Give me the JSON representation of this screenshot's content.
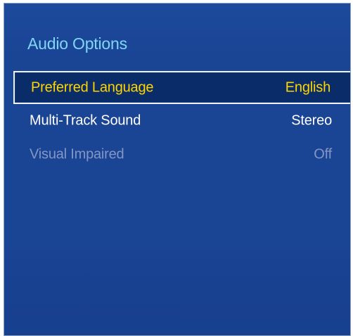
{
  "panel": {
    "title": "Audio Options"
  },
  "menu": {
    "items": [
      {
        "label": "Preferred Language",
        "value": "English",
        "state": "selected"
      },
      {
        "label": "Multi-Track Sound",
        "value": "Stereo",
        "state": "normal"
      },
      {
        "label": "Visual Impaired",
        "value": "Off",
        "state": "disabled"
      }
    ]
  },
  "colors": {
    "background": "#1a4494",
    "title": "#7fd6f7",
    "selected_text": "#ffd400",
    "normal_text": "#ffffff",
    "disabled_text": "#8497c4"
  }
}
